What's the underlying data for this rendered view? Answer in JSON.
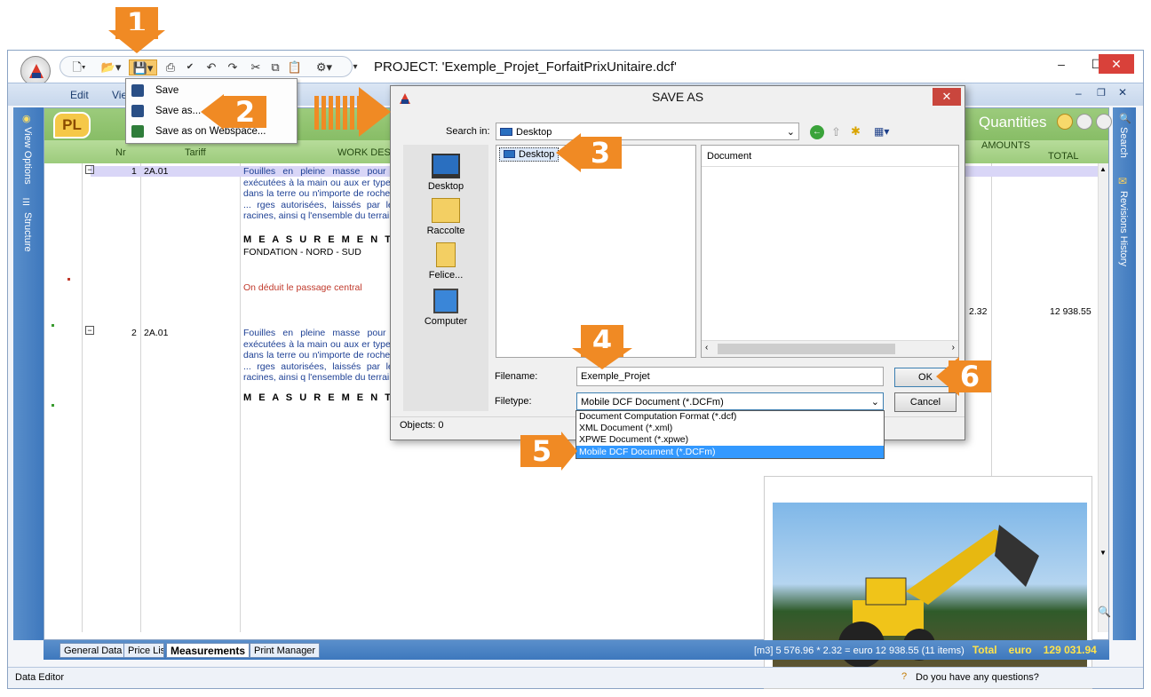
{
  "window": {
    "project_title": "PROJECT: 'Exemple_Projet_ForfaitPrixUnitaire.dcf'"
  },
  "menubar": {
    "items": [
      "Edit",
      "Vie"
    ]
  },
  "leftbar": {
    "items": [
      "View Options",
      "Structure"
    ]
  },
  "rightbar": {
    "items": [
      "Search",
      "Revisions History"
    ]
  },
  "doc": {
    "logo": "PL",
    "panel_title": "Quantities",
    "columns": {
      "nr": "Nr",
      "tariff": "Tariff",
      "work_desc": "WORK DESCR",
      "amounts": "AMOUNTS",
      "total": "TOTAL"
    },
    "rows": [
      {
        "nr": "1",
        "tariff": "2A.01",
        "desc": "Fouilles en pleine masse pour c exécutées à la main ou aux er types, dans la terre ou n'importe de rochers ... rges autorisées, laissés par les racines, ainsi q l'ensemble du terrain.",
        "measurements_label": "M E A S U R E M E N T S:",
        "measurement_line": "FONDATION - NORD - SUD",
        "deduction": "On déduit le passage central",
        "qty_fragment": "2.32",
        "total": "12 938.55"
      },
      {
        "nr": "2",
        "tariff": "2A.01",
        "desc": "Fouilles en pleine masse pour c exécutées à la main ou aux er types, dans la terre ou n'importe de rochers ... rges autorisées, laissés par les racines, ainsi q l'ensemble du terrain.",
        "measurements_label": "M E A S U R E M E N T S:"
      }
    ]
  },
  "tabs": [
    "General Data",
    "Price List",
    "Measurements",
    "Print Manager"
  ],
  "summary": {
    "text": "[m3] 5 576.96 * 2.32 = euro 12 938.55   (11 items)",
    "total_label": "Total",
    "currency": "euro",
    "total_value": "129 031.94"
  },
  "statusbar": {
    "left": "Data Editor",
    "help": "Do you have any questions?"
  },
  "save_menu": {
    "items": [
      "Save",
      "Save as...",
      "Save as on Webspace..."
    ]
  },
  "dialog": {
    "title": "SAVE AS",
    "search_in_label": "Search in:",
    "search_in_value": "Desktop",
    "places": [
      "Desktop",
      "Raccolte",
      "Felice...",
      "Computer"
    ],
    "folder_item": "Desktop",
    "right_list_header": "Document",
    "filename_label": "Filename:",
    "filename_value": "Exemple_Projet",
    "filetype_label": "Filetype:",
    "filetype_value": "Mobile DCF Document (*.DCFm)",
    "filetype_options": [
      "Document Computation Format (*.dcf)",
      "XML Document (*.xml)",
      "XPWE Document (*.xpwe)",
      "Mobile DCF Document (*.DCFm)"
    ],
    "ok": "OK",
    "cancel": "Cancel",
    "objects": "Objects: 0"
  },
  "callouts": [
    "1",
    "2",
    "3",
    "4",
    "5",
    "6"
  ],
  "colors": {
    "accent_orange": "#f08a24",
    "ribbon_blue": "#3e78bd",
    "header_green": "#79b356",
    "highlight": "#3399ff"
  }
}
